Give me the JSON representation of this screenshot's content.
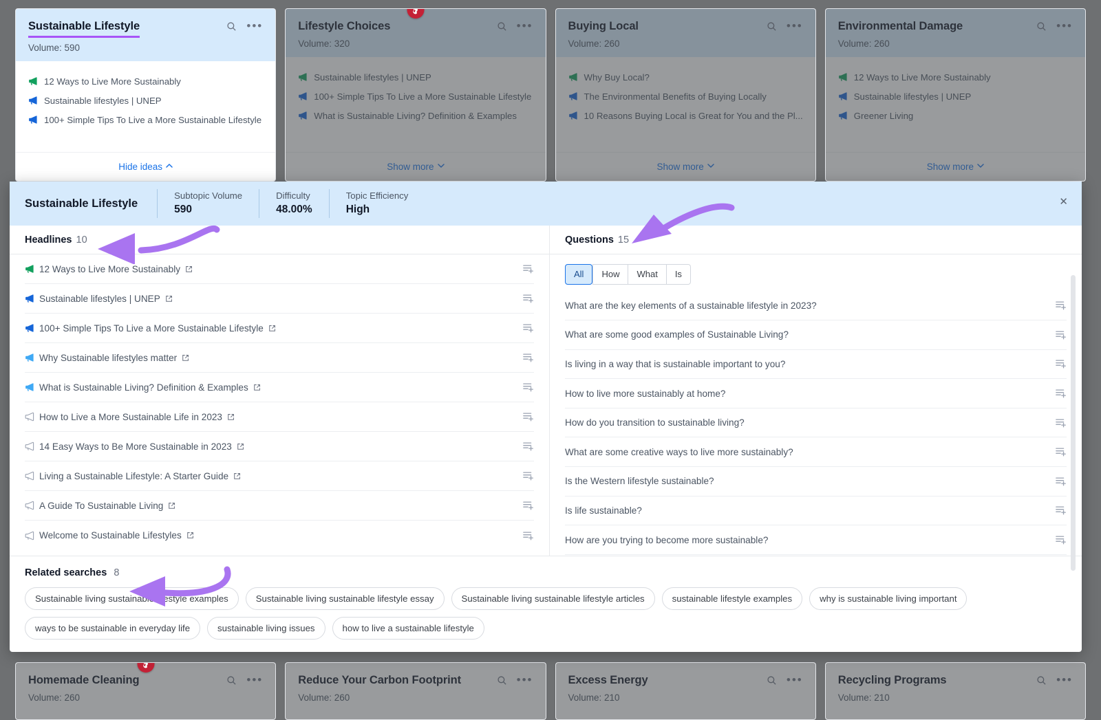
{
  "top_cards": [
    {
      "title": "Sustainable Lifestyle",
      "volume_label": "Volume: 590",
      "focused": true,
      "flame": false,
      "ideas": [
        {
          "text": "12 Ways to Live More Sustainably",
          "icon": "megaphone-green"
        },
        {
          "text": "Sustainable lifestyles | UNEP",
          "icon": "megaphone-blue"
        },
        {
          "text": "100+ Simple Tips To Live a More Sustainable Lifestyle",
          "icon": "megaphone-blue"
        }
      ],
      "footer_label": "Hide ideas",
      "footer_chevron": "up"
    },
    {
      "title": "Lifestyle Choices",
      "volume_label": "Volume: 320",
      "focused": false,
      "flame": true,
      "ideas": [
        {
          "text": "Sustainable lifestyles | UNEP",
          "icon": "megaphone-green"
        },
        {
          "text": "100+ Simple Tips To Live a More Sustainable Lifestyle",
          "icon": "megaphone-blue"
        },
        {
          "text": "What is Sustainable Living? Definition & Examples",
          "icon": "megaphone-blue"
        }
      ],
      "footer_label": "Show more",
      "footer_chevron": "down"
    },
    {
      "title": "Buying Local",
      "volume_label": "Volume: 260",
      "focused": false,
      "flame": false,
      "ideas": [
        {
          "text": "Why Buy Local?",
          "icon": "megaphone-green"
        },
        {
          "text": "The Environmental Benefits of Buying Locally",
          "icon": "megaphone-blue"
        },
        {
          "text": "10 Reasons Buying Local is Great for You and the Pl...",
          "icon": "megaphone-blue"
        }
      ],
      "footer_label": "Show more",
      "footer_chevron": "down"
    },
    {
      "title": "Environmental Damage",
      "volume_label": "Volume: 260",
      "focused": false,
      "flame": false,
      "ideas": [
        {
          "text": "12 Ways to Live More Sustainably",
          "icon": "megaphone-green"
        },
        {
          "text": "Sustainable lifestyles | UNEP",
          "icon": "megaphone-blue"
        },
        {
          "text": "Greener Living",
          "icon": "megaphone-blue"
        }
      ],
      "footer_label": "Show more",
      "footer_chevron": "down"
    }
  ],
  "bottom_cards": [
    {
      "title": "Homemade Cleaning",
      "volume_label": "Volume: 260",
      "flame": true
    },
    {
      "title": "Reduce Your Carbon Footprint",
      "volume_label": "Volume: 260",
      "flame": false
    },
    {
      "title": "Excess Energy",
      "volume_label": "Volume: 210",
      "flame": false
    },
    {
      "title": "Recycling Programs",
      "volume_label": "Volume: 210",
      "flame": false
    }
  ],
  "detail": {
    "topic": "Sustainable Lifestyle",
    "metrics": [
      {
        "label": "Subtopic Volume",
        "value": "590"
      },
      {
        "label": "Difficulty",
        "value": "48.00%"
      },
      {
        "label": "Topic Efficiency",
        "value": "High"
      }
    ],
    "close_label": "✕",
    "headlines": {
      "title": "Headlines",
      "count": "10",
      "items": [
        {
          "text": "12 Ways to Live More Sustainably",
          "icon": "megaphone-green"
        },
        {
          "text": "Sustainable lifestyles | UNEP",
          "icon": "megaphone-blue"
        },
        {
          "text": "100+ Simple Tips To Live a More Sustainable Lifestyle",
          "icon": "megaphone-blue"
        },
        {
          "text": "Why Sustainable lifestyles matter",
          "icon": "megaphone-lightblue"
        },
        {
          "text": "What is Sustainable Living? Definition & Examples",
          "icon": "megaphone-lightblue"
        },
        {
          "text": "How to Live a More Sustainable Life in 2023",
          "icon": "megaphone-gray"
        },
        {
          "text": "14 Easy Ways to Be More Sustainable in 2023",
          "icon": "megaphone-gray"
        },
        {
          "text": "Living a Sustainable Lifestyle: A Starter Guide",
          "icon": "megaphone-gray"
        },
        {
          "text": "A Guide To Sustainable Living",
          "icon": "megaphone-gray"
        },
        {
          "text": "Welcome to Sustainable Lifestyles",
          "icon": "megaphone-gray"
        }
      ]
    },
    "questions": {
      "title": "Questions",
      "count": "15",
      "filters": [
        {
          "label": "All",
          "active": true
        },
        {
          "label": "How",
          "active": false
        },
        {
          "label": "What",
          "active": false
        },
        {
          "label": "Is",
          "active": false
        }
      ],
      "items": [
        "What are the key elements of a sustainable lifestyle in 2023?",
        "What are some good examples of Sustainable Living?",
        "Is living in a way that is sustainable important to you?",
        "How to live more sustainably at home?",
        "How do you transition to sustainable living?",
        "What are some creative ways to live more sustainably?",
        "Is the Western lifestyle sustainable?",
        "Is life sustainable?",
        "How are you trying to become more sustainable?"
      ]
    },
    "related": {
      "title": "Related searches",
      "count": "8",
      "chips": [
        "Sustainable living sustainable lifestyle examples",
        "Sustainable living sustainable lifestyle essay",
        "Sustainable living sustainable lifestyle articles",
        "sustainable lifestyle examples",
        "why is sustainable living important",
        "ways to be sustainable in everyday life",
        "sustainable living issues",
        "how to live a sustainable lifestyle"
      ]
    }
  },
  "colors": {
    "accent_blue": "#1a73e8",
    "header_blue": "#d6eafc",
    "annotation_purple": "#a855f7",
    "flame_red": "#c42136",
    "megaphone_green": "#12a05e",
    "megaphone_blue": "#1565d8",
    "megaphone_lightblue": "#3fa9f5",
    "megaphone_gray": "#9aa2b1"
  }
}
